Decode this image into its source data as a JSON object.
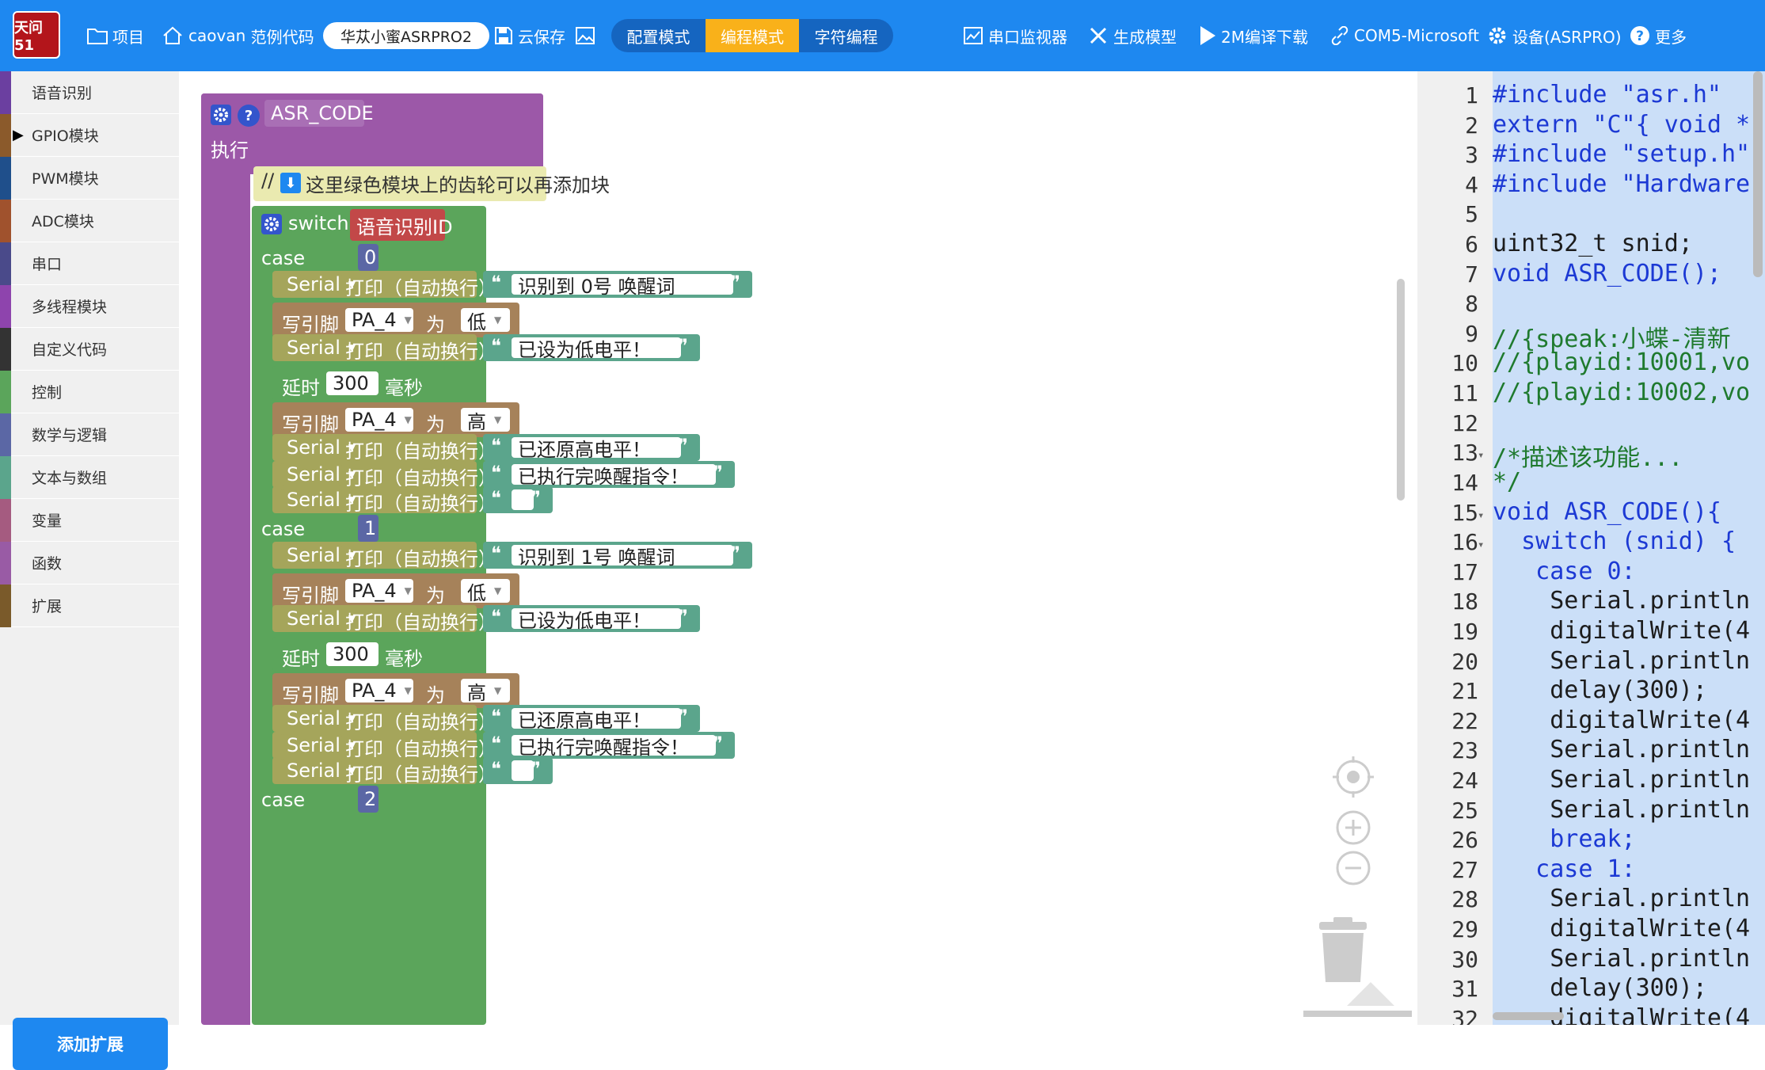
{
  "topbar": {
    "logo_text": "天问51",
    "project_label": "项目",
    "user_label": "caovan",
    "examples_label": "范例代码",
    "board_label": "华苁小蜜ASRPRO2",
    "cloud_save_label": "云保存",
    "modes": [
      "配置模式",
      "编程模式",
      "字符编程"
    ],
    "active_mode": "编程模式",
    "serial_monitor_label": "串口监视器",
    "gen_model_label": "生成模型",
    "compile_label": "2M编译下载",
    "com_label": "COM5-Microsoft",
    "device_label": "设备(ASRPRO)",
    "more_label": "更多",
    "accent_color": "#1e88f0",
    "active_mode_color": "#f9b11a"
  },
  "sidebar": {
    "categories": [
      {
        "label": "语音识别",
        "color": "#6b3fa0"
      },
      {
        "label": "GPIO模块",
        "color": "#8b5a2b",
        "expanded": true
      },
      {
        "label": "PWM模块",
        "color": "#1f4f8b"
      },
      {
        "label": "ADC模块",
        "color": "#a0522d"
      },
      {
        "label": "串口",
        "color": "#4a4a8a"
      },
      {
        "label": "多线程模块",
        "color": "#8e44ad"
      },
      {
        "label": "自定义代码",
        "color": "#333333"
      },
      {
        "label": "控制",
        "color": "#5ba55b"
      },
      {
        "label": "数学与逻辑",
        "color": "#5b67a5"
      },
      {
        "label": "文本与数组",
        "color": "#5ba58c"
      },
      {
        "label": "变量",
        "color": "#a55b80"
      },
      {
        "label": "函数",
        "color": "#995ba5"
      },
      {
        "label": "扩展",
        "color": "#7a5a2a"
      }
    ],
    "add_extension_label": "添加扩展"
  },
  "blocks": {
    "func_name": "ASR_CODE",
    "exec_label": "执行",
    "comment_prefix": "//",
    "comment_text": "这里绿色模块上的齿轮可以再添加块",
    "switch_label": "switch",
    "switch_value": "语音识别ID",
    "case_label": "case",
    "serial_label": "Serial",
    "print_label": "打印（自动换行）",
    "write_pin_label": "写引脚",
    "pin_value": "PA_4",
    "as_label": "为",
    "low_label": "低",
    "high_label": "高",
    "delay_label": "延时",
    "delay_value": "300",
    "ms_label": "毫秒",
    "cases": [
      {
        "value": "0",
        "msgs": [
          "识别到 0号 唤醒词",
          "已设为低电平！",
          "已还原高电平！",
          "已执行完唤醒指令！",
          ""
        ]
      },
      {
        "value": "1",
        "msgs": [
          "识别到 1号 唤醒词",
          "已设为低电平！",
          "已还原高电平！",
          "已执行完唤醒指令！",
          ""
        ]
      },
      {
        "value": "2"
      }
    ]
  },
  "code": {
    "line_numbers": [
      "1",
      "2",
      "3",
      "4",
      "5",
      "6",
      "7",
      "8",
      "9",
      "10",
      "11",
      "12",
      "13",
      "14",
      "15",
      "16",
      "17",
      "18",
      "19",
      "20",
      "21",
      "22",
      "23",
      "24",
      "25",
      "26",
      "27",
      "28",
      "29",
      "30",
      "31",
      "32"
    ],
    "lines": [
      "#include \"asr.h\"",
      "extern \"C\"{ void *",
      "#include \"setup.h\"",
      "#include \"Hardware",
      "",
      "uint32_t snid;",
      "void ASR_CODE();",
      "",
      "//{speak:小蝶-清新",
      "//{playid:10001,vo",
      "//{playid:10002,vo",
      "",
      "/*描述该功能...",
      "*/",
      "void ASR_CODE(){",
      "  switch (snid) {",
      "   case 0:",
      "    Serial.println",
      "    digitalWrite(4",
      "    Serial.println",
      "    delay(300);",
      "    digitalWrite(4",
      "    Serial.println",
      "    Serial.println",
      "    Serial.println",
      "    break;",
      "   case 1:",
      "    Serial.println",
      "    digitalWrite(4",
      "    Serial.println",
      "    delay(300);",
      "    digitalWrite(4"
    ]
  }
}
